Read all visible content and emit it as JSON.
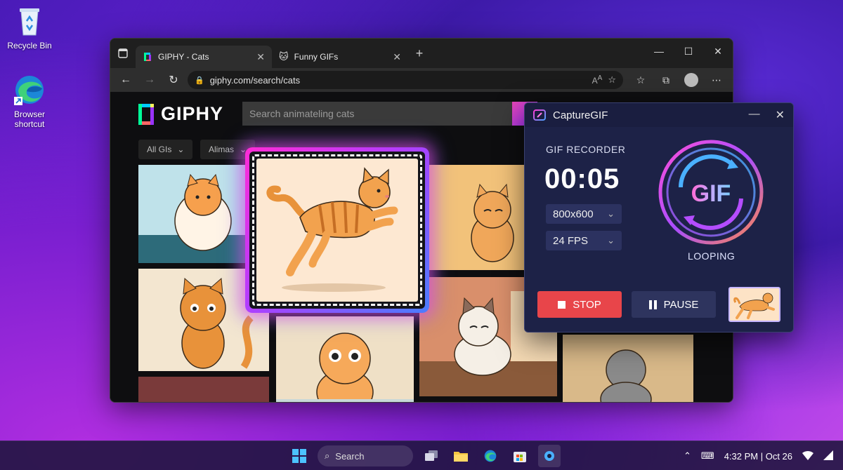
{
  "desktop": {
    "icons": [
      {
        "label": "Recycle Bin",
        "icon": "recycle-bin-icon"
      },
      {
        "label": "Browser\nshortcut",
        "icon": "edge-browser-icon"
      }
    ]
  },
  "browser": {
    "tabs": [
      {
        "label": "GIPHY - Cats",
        "active": true
      },
      {
        "label": "Funny GIFs",
        "active": false
      }
    ],
    "url": "giphy.com/search/cats",
    "page": {
      "logo_text": "GIPHY",
      "search_placeholder": "Search animateling cats",
      "filters": [
        "All GIs",
        "Alimas"
      ]
    }
  },
  "capture_app": {
    "title": "CaptureGIF",
    "section_label": "GIF RECORDER",
    "timer": "00:05",
    "resolution": "800x600",
    "fps": "24 FPS",
    "badge_text": "GIF",
    "loop_label": "LOOPING",
    "stop_label": "STOP",
    "pause_label": "PAUSE"
  },
  "taskbar": {
    "search_label": "Search",
    "time": "4:32 PM",
    "date": "Oct 26",
    "time_date": "4:32 PM | Oct 26"
  },
  "colors": {
    "stop": "#e8454a",
    "capture_frame_start": "#ff2bd6",
    "capture_frame_end": "#4a7dff",
    "app_bg": "#1d2247"
  }
}
